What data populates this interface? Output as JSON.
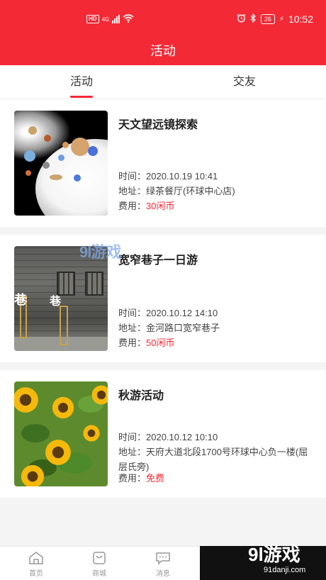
{
  "status_bar": {
    "hd": "HD",
    "net": "4G",
    "battery": "26",
    "time": "10:52"
  },
  "header": {
    "title": "活动"
  },
  "tabs": [
    {
      "label": "活动",
      "active": true
    },
    {
      "label": "交友",
      "active": false
    }
  ],
  "labels": {
    "time": "时间：",
    "address": "地址：",
    "fee": "费用："
  },
  "activities": [
    {
      "title": "天文望远镜探索",
      "time": "2020.10.19 10:41",
      "address": "绿茶餐厅(环球中心店)",
      "fee": "30闲币"
    },
    {
      "title": "宽窄巷子一日游",
      "time": "2020.10.12 14:10",
      "address": "金河路口宽窄巷子",
      "fee": "50闲币"
    },
    {
      "title": "秋游活动",
      "time": "2020.10.12 10:10",
      "address": "天府大道北段1700号环球中心负一楼(屈层氏旁)",
      "fee": "免费"
    }
  ],
  "bottom_nav": [
    {
      "label": "首页",
      "icon": "home-icon"
    },
    {
      "label": "商城",
      "icon": "shopping-bag-icon"
    },
    {
      "label": "消息",
      "icon": "message-icon"
    }
  ],
  "watermark": {
    "logo": "9l游戏",
    "url": "91danji.com",
    "overlay": "9l游戏"
  },
  "colors": {
    "accent": "#f32a36"
  }
}
